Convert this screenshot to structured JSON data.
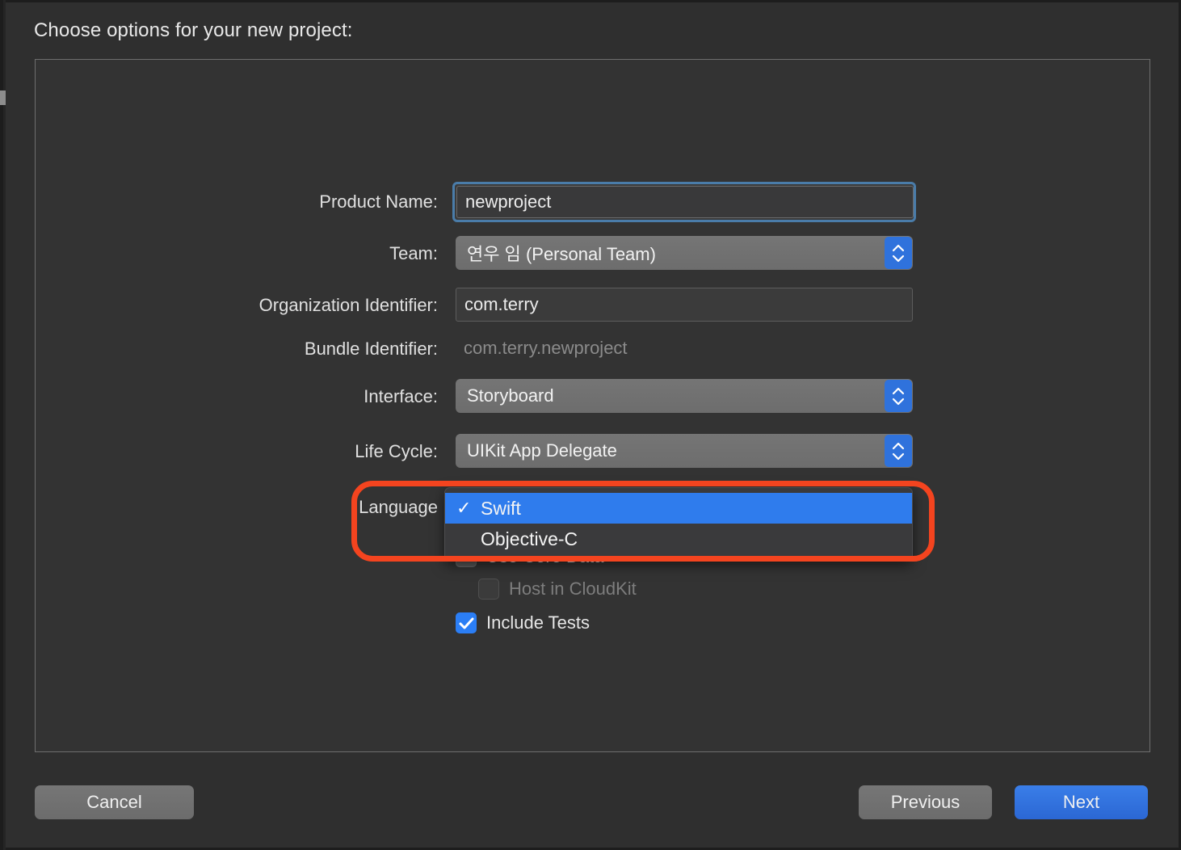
{
  "dialog": {
    "title": "Choose options for your new project:"
  },
  "form": {
    "rows": [
      {
        "label": "Product Name:",
        "value": "newproject",
        "type": "textfield-focused"
      },
      {
        "label": "Team:",
        "value": "연우 임 (Personal Team)",
        "type": "popup"
      },
      {
        "label": "Organization Identifier:",
        "value": "com.terry",
        "type": "textfield"
      },
      {
        "label": "Bundle Identifier:",
        "value": "com.terry.newproject",
        "type": "static"
      },
      {
        "label": "Interface:",
        "value": "Storyboard",
        "type": "popup"
      },
      {
        "label": "Life Cycle:",
        "value": "UIKit App Delegate",
        "type": "popup"
      },
      {
        "label": "Language",
        "value": "Swift",
        "type": "popup-open"
      }
    ]
  },
  "checkboxes": [
    {
      "label": "Use Core Data",
      "state": "unchecked"
    },
    {
      "label": "Host in CloudKit",
      "state": "disabled"
    },
    {
      "label": "Include Tests",
      "state": "checked"
    }
  ],
  "language_menu": {
    "items": [
      {
        "label": "Swift",
        "selected": true,
        "checkmark": "✓"
      },
      {
        "label": "Objective-C",
        "selected": false,
        "checkmark": ""
      }
    ]
  },
  "footer": {
    "cancel_label": "Cancel",
    "previous_label": "Previous",
    "next_label": "Next"
  },
  "annotation": {
    "shape": "rounded-rectangle",
    "color": "#f4441f"
  },
  "colors": {
    "accent_blue": "#2f72dc",
    "menu_highlight": "#2f7ced",
    "checkbox_blue": "#2b7ef5",
    "focus_ring": "#4a7ca9",
    "window_bg": "#2f2f2f",
    "panel_bg": "#333333",
    "annotation_red": "#f4441f"
  }
}
